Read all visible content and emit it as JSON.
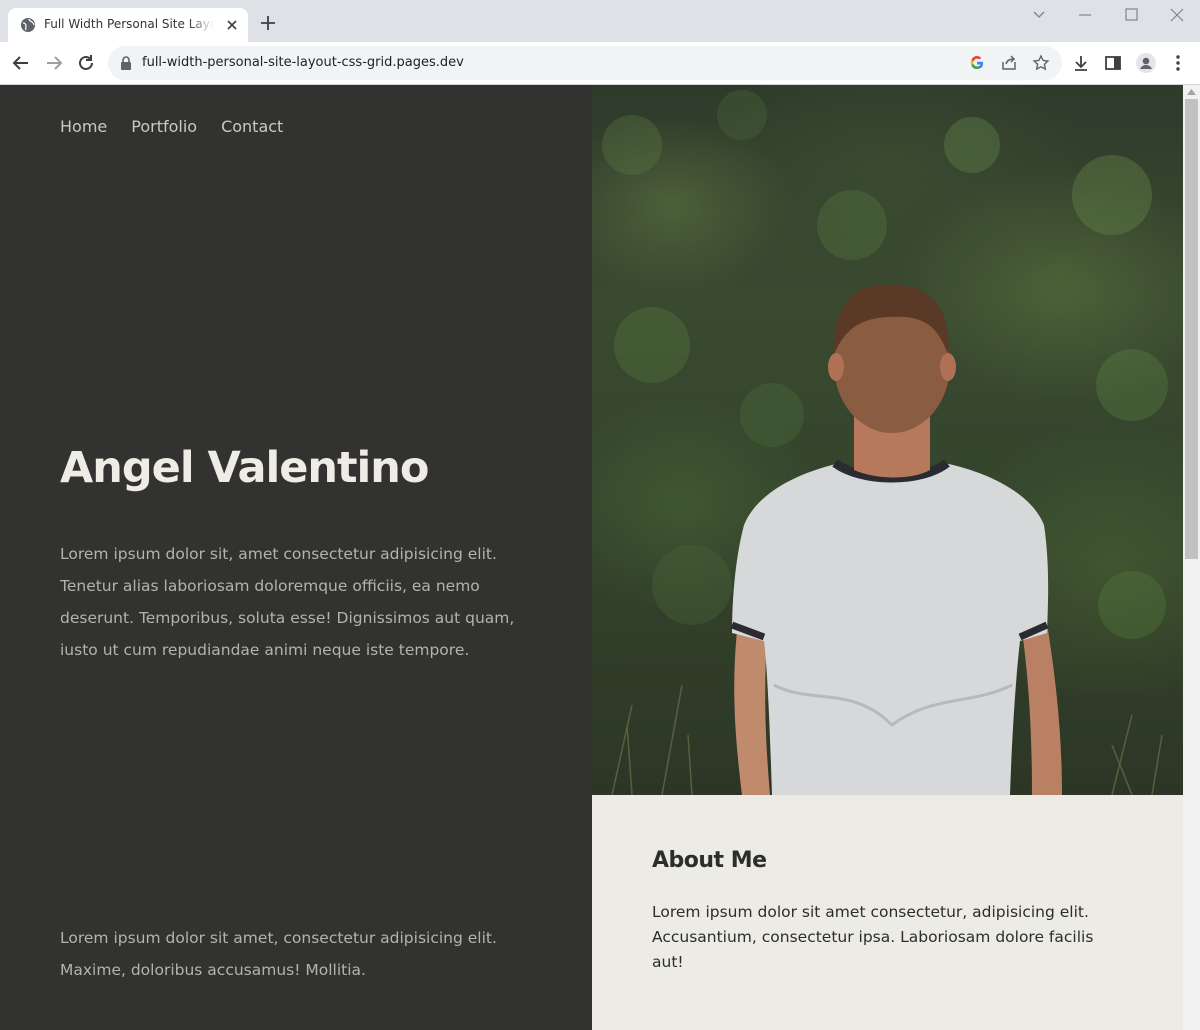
{
  "browser": {
    "tab_title": "Full Width Personal Site Layout CSS Grid",
    "url": "full-width-personal-site-layout-css-grid.pages.dev",
    "icons": [
      "globe-icon",
      "close-icon",
      "plus-icon",
      "chevron-down-icon",
      "minimize-icon",
      "maximize-icon",
      "window-close-icon",
      "back-icon",
      "forward-icon",
      "reload-icon",
      "lock-icon",
      "google-icon",
      "share-icon",
      "star-icon",
      "download-icon",
      "sidepanel-icon",
      "profile-icon",
      "menu-icon"
    ]
  },
  "nav": {
    "items": [
      "Home",
      "Portfolio",
      "Contact"
    ]
  },
  "hero": {
    "name": "Angel Valentino",
    "text": "Lorem ipsum dolor sit, amet consectetur adipisicing elit. Tenetur alias laboriosam doloremque officiis, ea nemo deserunt. Temporibus, soluta esse! Dignissimos aut quam, iusto ut cum repudiandae animi neque iste tempore."
  },
  "footer_left": {
    "text": "Lorem ipsum dolor sit amet, consectetur adipisicing elit. Maxime, doloribus accusamus! Mollitia."
  },
  "about": {
    "title": "About Me",
    "text": "Lorem ipsum dolor sit amet consectetur, adipisicing elit. Accusantium, consectetur ipsa. Laboriosam dolore facilis aut!"
  },
  "colors": {
    "left_bg": "#323230",
    "about_bg": "#ecebe6",
    "heading_light": "#efece6"
  }
}
